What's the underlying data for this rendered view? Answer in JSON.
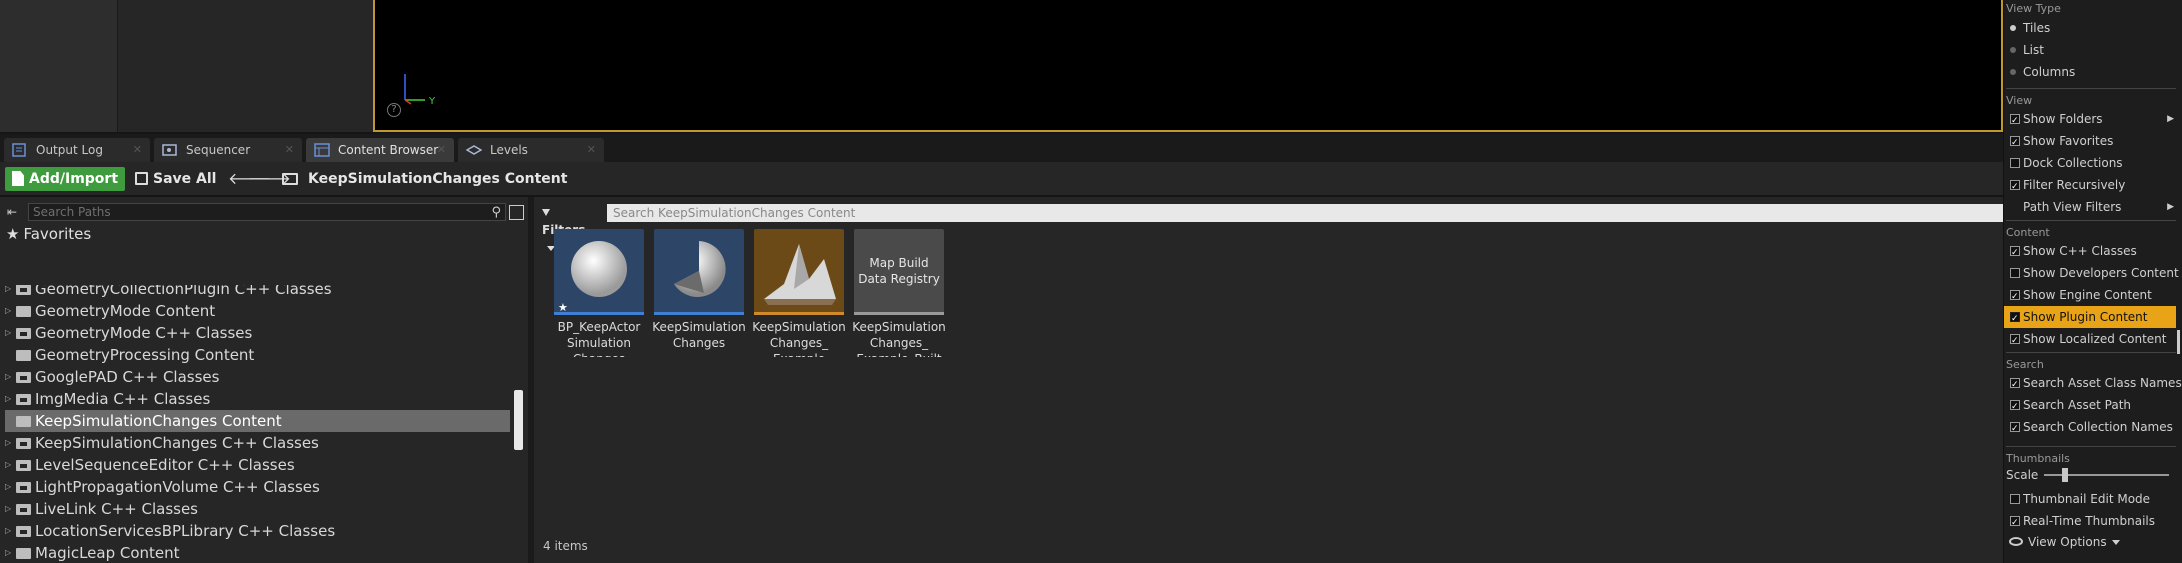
{
  "viewport": {
    "axis_y": "Y"
  },
  "tabs": [
    {
      "label": "Output Log",
      "icon": "output-log-icon"
    },
    {
      "label": "Sequencer",
      "icon": "sequencer-icon"
    },
    {
      "label": "Content Browser",
      "icon": "content-browser-icon",
      "active": true
    },
    {
      "label": "Levels",
      "icon": "levels-icon"
    }
  ],
  "toolbar": {
    "add_import_label": "Add/Import",
    "save_all_label": "Save All",
    "breadcrumb": "KeepSimulationChanges Content"
  },
  "sources": {
    "search_placeholder": "Search Paths",
    "favorites_label": "Favorites",
    "tree": [
      {
        "label": "GeometryCollectionPlugin C++ Classes",
        "expander": true,
        "folder": "class"
      },
      {
        "label": "GeometryMode Content",
        "expander": true,
        "folder": "content"
      },
      {
        "label": "GeometryMode C++ Classes",
        "expander": true,
        "folder": "class"
      },
      {
        "label": "GeometryProcessing Content",
        "expander": false,
        "folder": "content"
      },
      {
        "label": "GooglePAD C++ Classes",
        "expander": true,
        "folder": "class"
      },
      {
        "label": "ImgMedia C++ Classes",
        "expander": true,
        "folder": "class"
      },
      {
        "label": "KeepSimulationChanges Content",
        "expander": false,
        "folder": "content",
        "selected": true
      },
      {
        "label": "KeepSimulationChanges C++ Classes",
        "expander": true,
        "folder": "class"
      },
      {
        "label": "LevelSequenceEditor C++ Classes",
        "expander": true,
        "folder": "class"
      },
      {
        "label": "LightPropagationVolume C++ Classes",
        "expander": true,
        "folder": "class"
      },
      {
        "label": "LiveLink C++ Classes",
        "expander": true,
        "folder": "class"
      },
      {
        "label": "LocationServicesBPLibrary C++ Classes",
        "expander": true,
        "folder": "class"
      },
      {
        "label": "MagicLeap Content",
        "expander": true,
        "folder": "content"
      }
    ]
  },
  "assets": {
    "filters_label": "Filters",
    "search_placeholder": "Search KeepSimulationChanges Content",
    "items": [
      {
        "label": "BP_KeepActor Simulation Changes",
        "thumb_kind": "sphere",
        "bar_color": "#3f7fd6"
      },
      {
        "label": "KeepSimulation Changes",
        "thumb_kind": "cutsphere",
        "bar_color": "#3f7fd6"
      },
      {
        "label": "KeepSimulation Changes_ Example",
        "thumb_kind": "peaks",
        "bar_color": "#d08a2c"
      },
      {
        "label": "KeepSimulation Changes_ Example_Built",
        "thumb_text": "Map Build Data Registry",
        "thumb_kind": "registry",
        "bar_color": "#9a9a9a"
      }
    ],
    "count_text": "4 items"
  },
  "view_options": {
    "sections": [
      {
        "header": "View Type",
        "items": [
          {
            "label": "Tiles",
            "kind": "radio",
            "checked": true
          },
          {
            "label": "List",
            "kind": "radio",
            "checked": false
          },
          {
            "label": "Columns",
            "kind": "radio",
            "checked": false
          }
        ]
      },
      {
        "header": "View",
        "items": [
          {
            "label": "Show Folders",
            "kind": "check",
            "checked": true,
            "submenu": true
          },
          {
            "label": "Show Favorites",
            "kind": "check",
            "checked": true
          },
          {
            "label": "Dock Collections",
            "kind": "check",
            "checked": false
          },
          {
            "label": "Filter Recursively",
            "kind": "check",
            "checked": true
          },
          {
            "label": "Path View Filters",
            "kind": "none",
            "submenu": true
          }
        ]
      },
      {
        "header": "Content",
        "items": [
          {
            "label": "Show C++ Classes",
            "kind": "check",
            "checked": true
          },
          {
            "label": "Show Developers Content",
            "kind": "check",
            "checked": false
          },
          {
            "label": "Show Engine Content",
            "kind": "check",
            "checked": true
          },
          {
            "label": "Show Plugin Content",
            "kind": "check",
            "checked": true,
            "highlighted": true
          },
          {
            "label": "Show Localized Content",
            "kind": "check",
            "checked": true
          }
        ]
      },
      {
        "header": "Search",
        "items": [
          {
            "label": "Search Asset Class Names",
            "kind": "check",
            "checked": true
          },
          {
            "label": "Search Asset Path",
            "kind": "check",
            "checked": true
          },
          {
            "label": "Search Collection Names",
            "kind": "check",
            "checked": true
          }
        ]
      },
      {
        "header": "Thumbnails",
        "items": []
      }
    ],
    "scale_label": "Scale",
    "scale_value": 0.17,
    "thumb_items": [
      {
        "label": "Thumbnail Edit Mode",
        "kind": "check",
        "checked": false
      },
      {
        "label": "Real-Time Thumbnails",
        "kind": "check",
        "checked": true
      }
    ],
    "button_label": "View Options"
  },
  "colors": {
    "accent_yellow": "#e8a317",
    "add_green": "#3e9b3e",
    "viewport_border": "#c09830"
  }
}
